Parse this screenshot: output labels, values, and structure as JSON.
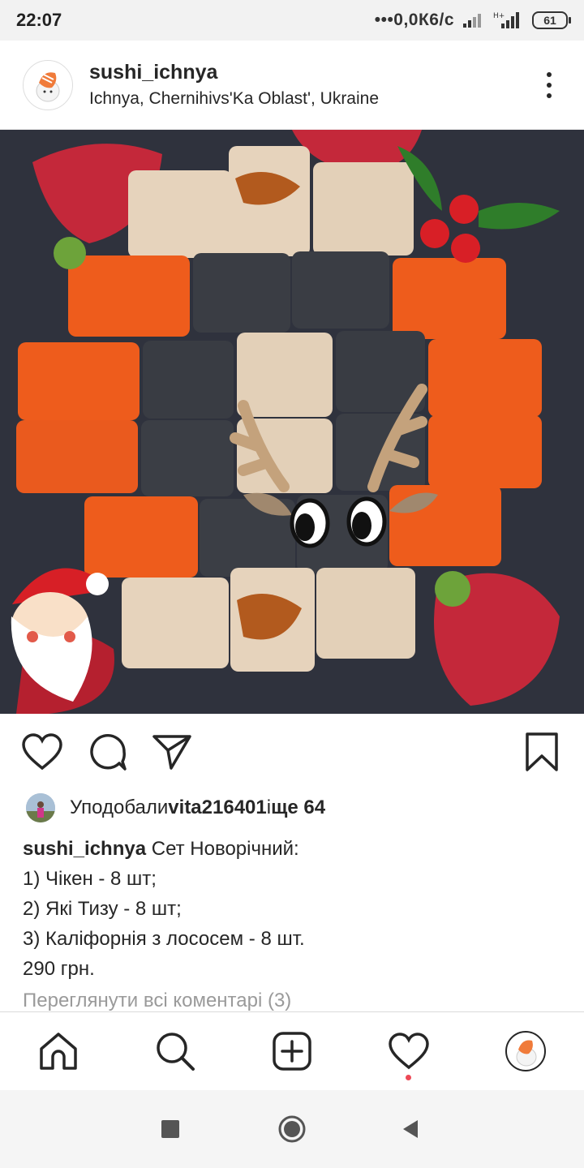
{
  "status_bar": {
    "time": "22:07",
    "network_speed": "0,0К6/с",
    "battery": "61"
  },
  "post": {
    "username": "sushi_ichnya",
    "location": "Ichnya, Chernihivs'Ka Oblast', Ukraine"
  },
  "likes": {
    "prefix": "Уподобали ",
    "user": "vita216401",
    "middle": " і ",
    "others": "ще 64"
  },
  "caption": {
    "username": "sushi_ichnya",
    "lines": [
      "Сет Новорічний:",
      "1) Чікен - 8 шт;",
      "2) Які Тизу - 8 шт;",
      "3) Каліфорнія з лососем - 8 шт.",
      "290 грн."
    ]
  },
  "view_comments": "Переглянути всі коментарі (3)",
  "icons": {
    "more": "more-vertical-icon",
    "like": "heart-icon",
    "comment": "comment-icon",
    "share": "send-icon",
    "save": "bookmark-icon",
    "home": "home-icon",
    "search": "search-icon",
    "add": "add-post-icon",
    "activity": "heart-icon",
    "profile": "profile-avatar"
  },
  "colors": {
    "text": "#262626",
    "muted": "#9a9a9a",
    "notification": "#ed4956"
  }
}
